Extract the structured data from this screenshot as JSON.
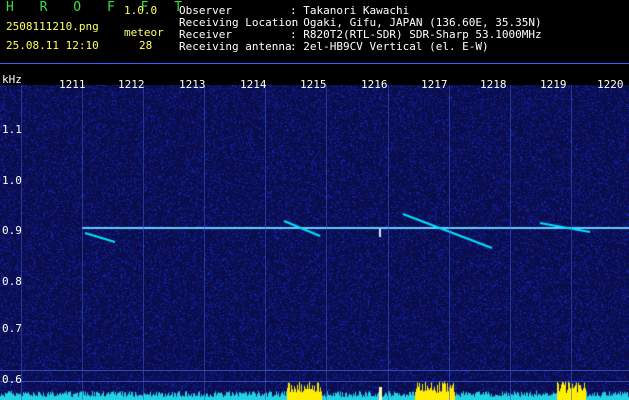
{
  "app": {
    "logo": "H R O F F T",
    "version": "1.0.0"
  },
  "file": {
    "name": "2508111210.png",
    "datetime": "25.08.11 12:10"
  },
  "meteor": {
    "label": "meteor",
    "count": "28"
  },
  "info": [
    {
      "key": "Observer",
      "value": ": Takanori Kawachi"
    },
    {
      "key": "Receiving Location",
      "value": ": Ogaki, Gifu, JAPAN (136.60E, 35.35N)"
    },
    {
      "key": "Receiver",
      "value": ": R820T2(RTL-SDR) SDR-Sharp 53.1000MHz"
    },
    {
      "key": "Receiving antenna",
      "value": ": 2el-HB9CV Vertical (el. E-W)"
    }
  ],
  "axis": {
    "unit": "kHz",
    "x_ticks": [
      "1211",
      "1212",
      "1213",
      "1214",
      "1215",
      "1216",
      "1217",
      "1218",
      "1219",
      "1220"
    ],
    "y_ticks": [
      "1.1",
      "1.0",
      "0.9",
      "0.8",
      "0.7",
      "0.6"
    ]
  },
  "colors": {
    "background": "#000000",
    "spectrum": "#0a0d4a",
    "carrier": "#66ccff",
    "trace": "#00e5ff",
    "peak": "#ffee00"
  }
}
